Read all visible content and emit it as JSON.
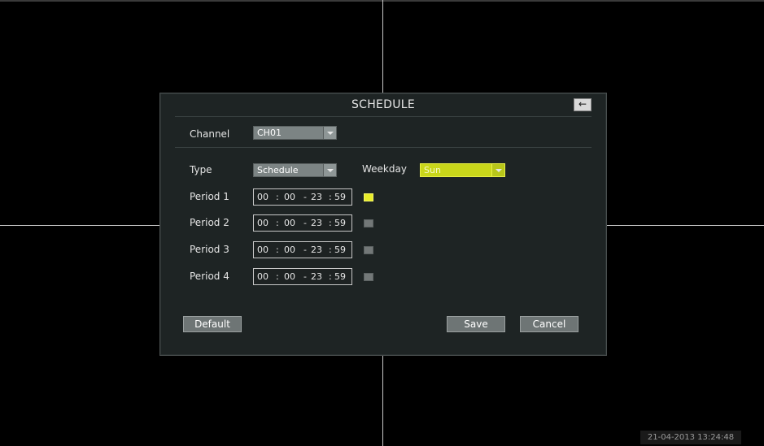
{
  "dialog": {
    "title": "SCHEDULE",
    "back_icon": "arrow-left-icon",
    "channel_label": "Channel",
    "channel_value": "CH01",
    "type_label": "Type",
    "type_value": "Schedule",
    "weekday_label": "Weekday",
    "weekday_value": "Sun",
    "periods": [
      {
        "label": "Period 1",
        "start_h": "00",
        "start_m": "00",
        "end_h": "23",
        "end_m": "59",
        "enabled": true
      },
      {
        "label": "Period 2",
        "start_h": "00",
        "start_m": "00",
        "end_h": "23",
        "end_m": "59",
        "enabled": false
      },
      {
        "label": "Period 3",
        "start_h": "00",
        "start_m": "00",
        "end_h": "23",
        "end_m": "59",
        "enabled": false
      },
      {
        "label": "Period 4",
        "start_h": "00",
        "start_m": "00",
        "end_h": "23",
        "end_m": "59",
        "enabled": false
      }
    ],
    "time_separator": ":",
    "range_separator": "-",
    "default_label": "Default",
    "save_label": "Save",
    "cancel_label": "Cancel"
  },
  "status": {
    "datetime": "21-04-2013 13:24:48"
  },
  "colors": {
    "accent": "#c9d61a",
    "enabled_check": "#e8ec2a"
  }
}
